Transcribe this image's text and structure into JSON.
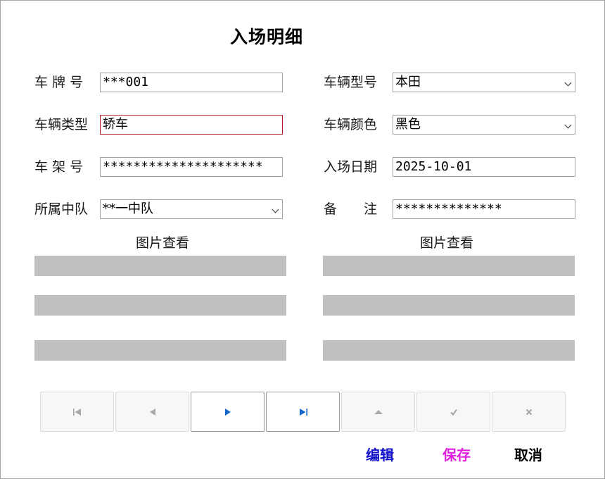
{
  "title": "入场明细",
  "left_fields": [
    {
      "label": "车 牌 号",
      "value": "***001"
    },
    {
      "label": "车辆类型",
      "value": "轿车"
    },
    {
      "label": "车 架 号",
      "value": "*********************"
    },
    {
      "label": "所属中队",
      "value": "**一中队"
    }
  ],
  "right_fields": [
    {
      "label": "车辆型号",
      "value": "本田"
    },
    {
      "label": "车辆颜色",
      "value": "黑色"
    },
    {
      "label": "入场日期",
      "value": "2025-10-01"
    },
    {
      "label": "备　　注",
      "value": "**************"
    }
  ],
  "photo_section": {
    "left_heading": "图片查看",
    "right_heading": "图片查看"
  },
  "navigator": {
    "buttons": [
      {
        "icon": "first-record-icon",
        "enabled": false
      },
      {
        "icon": "prev-record-icon",
        "enabled": false
      },
      {
        "icon": "next-record-icon",
        "enabled": true
      },
      {
        "icon": "last-record-icon",
        "enabled": true
      },
      {
        "icon": "edit-triangle-icon",
        "enabled": false
      },
      {
        "icon": "post-check-icon",
        "enabled": false
      },
      {
        "icon": "cancel-x-icon",
        "enabled": false
      }
    ],
    "enabled_color": "#1565c8",
    "disabled_color": "#a8a8a8"
  },
  "actions": {
    "edit_label": "编辑",
    "save_label": "保存",
    "cancel_label": "取消",
    "edit_color": "#1111cc",
    "save_color": "#e020e0",
    "cancel_color": "#000000"
  }
}
